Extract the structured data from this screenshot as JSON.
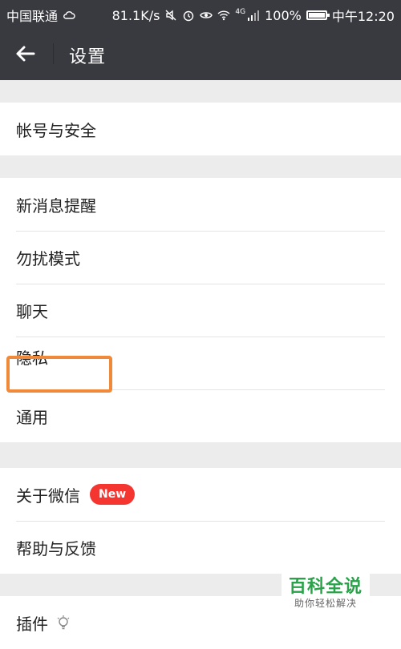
{
  "status_bar": {
    "carrier": "中国联通",
    "network_speed": "81.1K/s",
    "network_type": "4G",
    "battery": "100%",
    "time": "中午12:20"
  },
  "header": {
    "title": "设置"
  },
  "groups": [
    {
      "items": [
        {
          "label": "帐号与安全"
        }
      ]
    },
    {
      "items": [
        {
          "label": "新消息提醒"
        },
        {
          "label": "勿扰模式"
        },
        {
          "label": "聊天"
        },
        {
          "label": "隐私"
        },
        {
          "label": "通用"
        }
      ]
    },
    {
      "items": [
        {
          "label": "关于微信",
          "badge": "New"
        },
        {
          "label": "帮助与反馈"
        }
      ]
    },
    {
      "items": [
        {
          "label": "插件"
        }
      ]
    }
  ],
  "watermark": {
    "title": "百科全说",
    "subtitle": "助你轻松解决"
  },
  "colors": {
    "bar_bg": "#393a3f",
    "page_bg": "#ececec",
    "badge": "#f43530",
    "highlight": "#f08a3a",
    "watermark_green": "#2aa24a"
  }
}
